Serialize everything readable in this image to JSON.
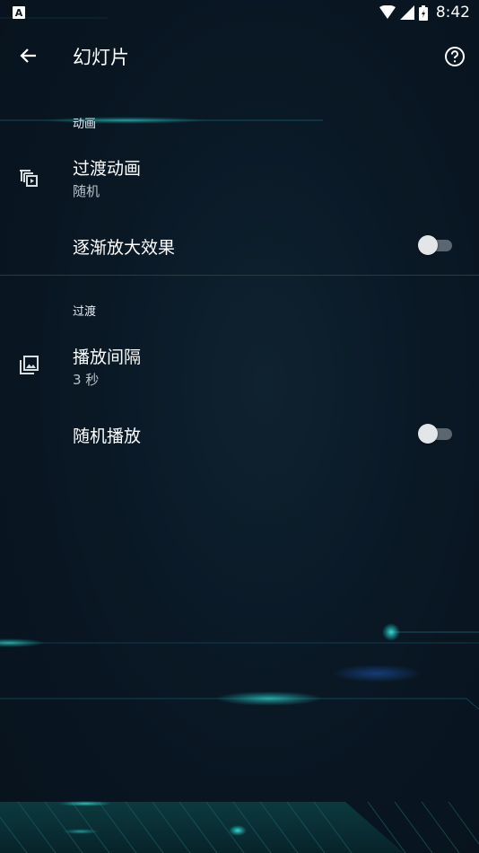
{
  "status_bar": {
    "time": "8:42",
    "notification_icon": "a-icon"
  },
  "app_bar": {
    "title": "幻灯片",
    "back_icon": "arrow-back-icon",
    "help_icon": "help-circle-icon"
  },
  "sections": [
    {
      "header": "动画",
      "items": [
        {
          "title": "过渡动画",
          "summary": "随机",
          "icon": "slideshow-transition-icon"
        },
        {
          "title": "逐渐放大效果",
          "toggle": false
        }
      ]
    },
    {
      "header": "过渡",
      "items": [
        {
          "title": "播放间隔",
          "summary": "3 秒",
          "icon": "photo-library-icon"
        },
        {
          "title": "随机播放",
          "toggle": false
        }
      ]
    }
  ],
  "colors": {
    "background": "#0a1825",
    "accent_glow": "#19d6d0",
    "switch_off_track": "#5b6670"
  }
}
